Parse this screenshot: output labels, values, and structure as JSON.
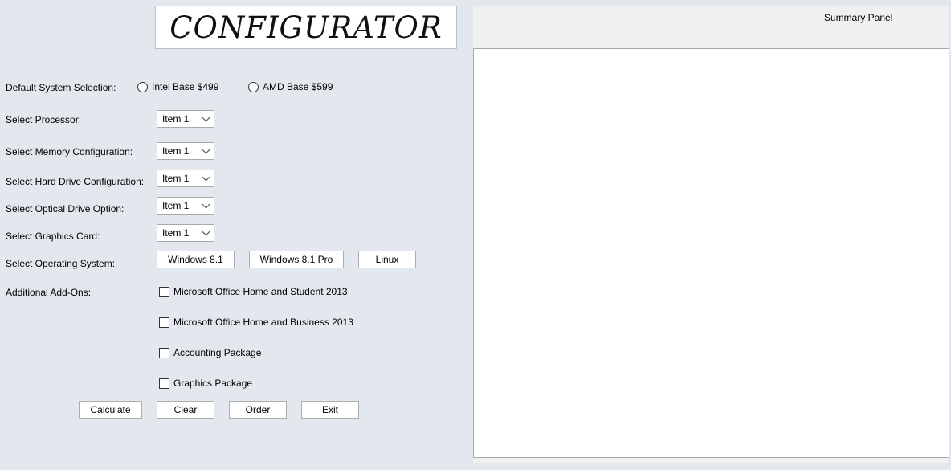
{
  "logo": {
    "text": "CONFIGURATOR"
  },
  "default_system": {
    "label": "Default System Selection:",
    "options": [
      "Intel Base $499",
      "AMD Base $599"
    ]
  },
  "processor": {
    "label": "Select Processor:",
    "value": "Item 1"
  },
  "memory": {
    "label": "Select Memory Configuration:",
    "value": "Item 1"
  },
  "hard_drive": {
    "label": "Select Hard Drive Configuration:",
    "value": "Item 1"
  },
  "optical": {
    "label": "Select Optical Drive Option:",
    "value": "Item 1"
  },
  "graphics": {
    "label": "Select Graphics Card:",
    "value": "Item 1"
  },
  "os": {
    "label": "Select Operating System:",
    "buttons": [
      "Windows 8.1",
      "Windows 8.1 Pro",
      "Linux"
    ]
  },
  "addons": {
    "label": "Additional Add-Ons:",
    "items": [
      "Microsoft Office Home and Student 2013",
      "Microsoft Office Home and Business 2013",
      "Accounting Package",
      "Graphics Package"
    ]
  },
  "actions": [
    "Calculate",
    "Clear",
    "Order",
    "Exit"
  ],
  "summary": {
    "title": "Summary Panel"
  }
}
